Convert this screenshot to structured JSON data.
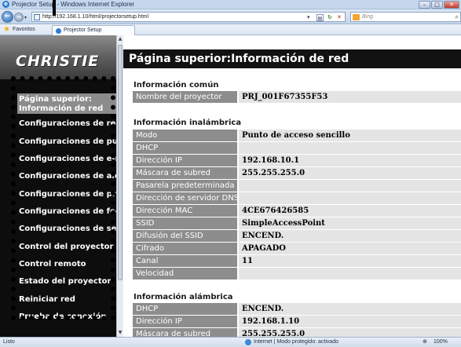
{
  "browser": {
    "window_title": "Projector Setup - Windows Internet Explorer",
    "address_url": "http://192.168.1.10/html/projectorsetup.html",
    "search_placeholder": "Bing",
    "favorites_label": "Favoritos",
    "tab_label": "Projector Setup",
    "status_left": "Listo",
    "status_zone": "Internet | Modo protegido: activado",
    "zoom": "100%"
  },
  "sidebar": {
    "logo_text": "CHRISTIE",
    "active_item": "Página superior: Información de red",
    "items": [
      "Configuraciones de red",
      "Configuraciones de puerto",
      "Configuraciones de e-mail",
      "Configuraciones de alerta",
      "Configuraciones de programa",
      "Configuraciones de fecha",
      "Configuraciones de seguridad",
      "Control del proyector",
      "Control remoto",
      "Estado del proyector",
      "Reiniciar red",
      "Prueba de conexión"
    ]
  },
  "main": {
    "title": "Página superior:Información de red",
    "common": {
      "heading": "Información común",
      "rows": [
        {
          "label": "Nombre del proyector",
          "value": "PRJ_001F67355F53"
        }
      ]
    },
    "wireless": {
      "heading": "Información inalámbrica",
      "rows": [
        {
          "label": "Modo",
          "value": "Punto de acceso sencillo"
        },
        {
          "label": "DHCP",
          "value": ""
        },
        {
          "label": "Dirección IP",
          "value": "192.168.10.1"
        },
        {
          "label": "Máscara de subred",
          "value": "255.255.255.0"
        },
        {
          "label": "Pasarela predeterminada",
          "value": ""
        },
        {
          "label": "Dirección de servidor DNS",
          "value": ""
        },
        {
          "label": "Dirección MAC",
          "value": "4CE676426585"
        },
        {
          "label": "SSID",
          "value": "SimpleAccessPoint"
        },
        {
          "label": "Difusión del SSID",
          "value": "ENCEND."
        },
        {
          "label": "Cifrado",
          "value": "APAGADO"
        },
        {
          "label": "Canal",
          "value": "11"
        },
        {
          "label": "Velocidad",
          "value": ""
        }
      ]
    },
    "wired": {
      "heading": "Información alámbrica",
      "rows": [
        {
          "label": "DHCP",
          "value": "ENCEND."
        },
        {
          "label": "Dirección IP",
          "value": "192.168.1.10"
        },
        {
          "label": "Máscara de subred",
          "value": "255.255.255.0"
        }
      ]
    }
  }
}
